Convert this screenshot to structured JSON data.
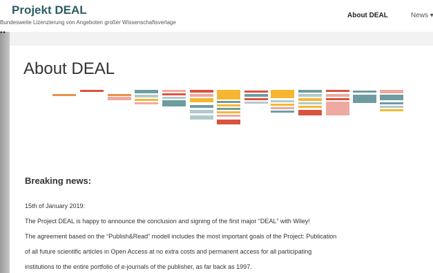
{
  "site": {
    "title": "Projekt DEAL",
    "subtitle": "Bundesweite Lizenzierung von Angeboten großer Wissenschaftsverlage"
  },
  "nav": {
    "about": "About DEAL",
    "news": "News ▾"
  },
  "page": {
    "title": "About DEAL"
  },
  "news": {
    "heading": "Breaking news:",
    "date": "15th of January 2019:",
    "lines": [
      "The Project DEAL is happy to announce the conclusion and signing of the first major “DEAL” with Wiley!",
      "The agreement based on the “Publish&Read” modell includes the most important goals of the Project: Publication",
      "of all future scientific articles in Open Access at no extra costs and permanent access for all participating",
      "institutions to the entire portfolio of e-journals of the publisher, as far back as 1997."
    ]
  },
  "colors": {
    "title": "#2b5d63",
    "orange": "#e8924a",
    "red": "#d9533f",
    "teal": "#6f9ca0",
    "yellow": "#f5b731",
    "pink": "#eeaaa0",
    "lightteal": "#b2c9cb"
  }
}
